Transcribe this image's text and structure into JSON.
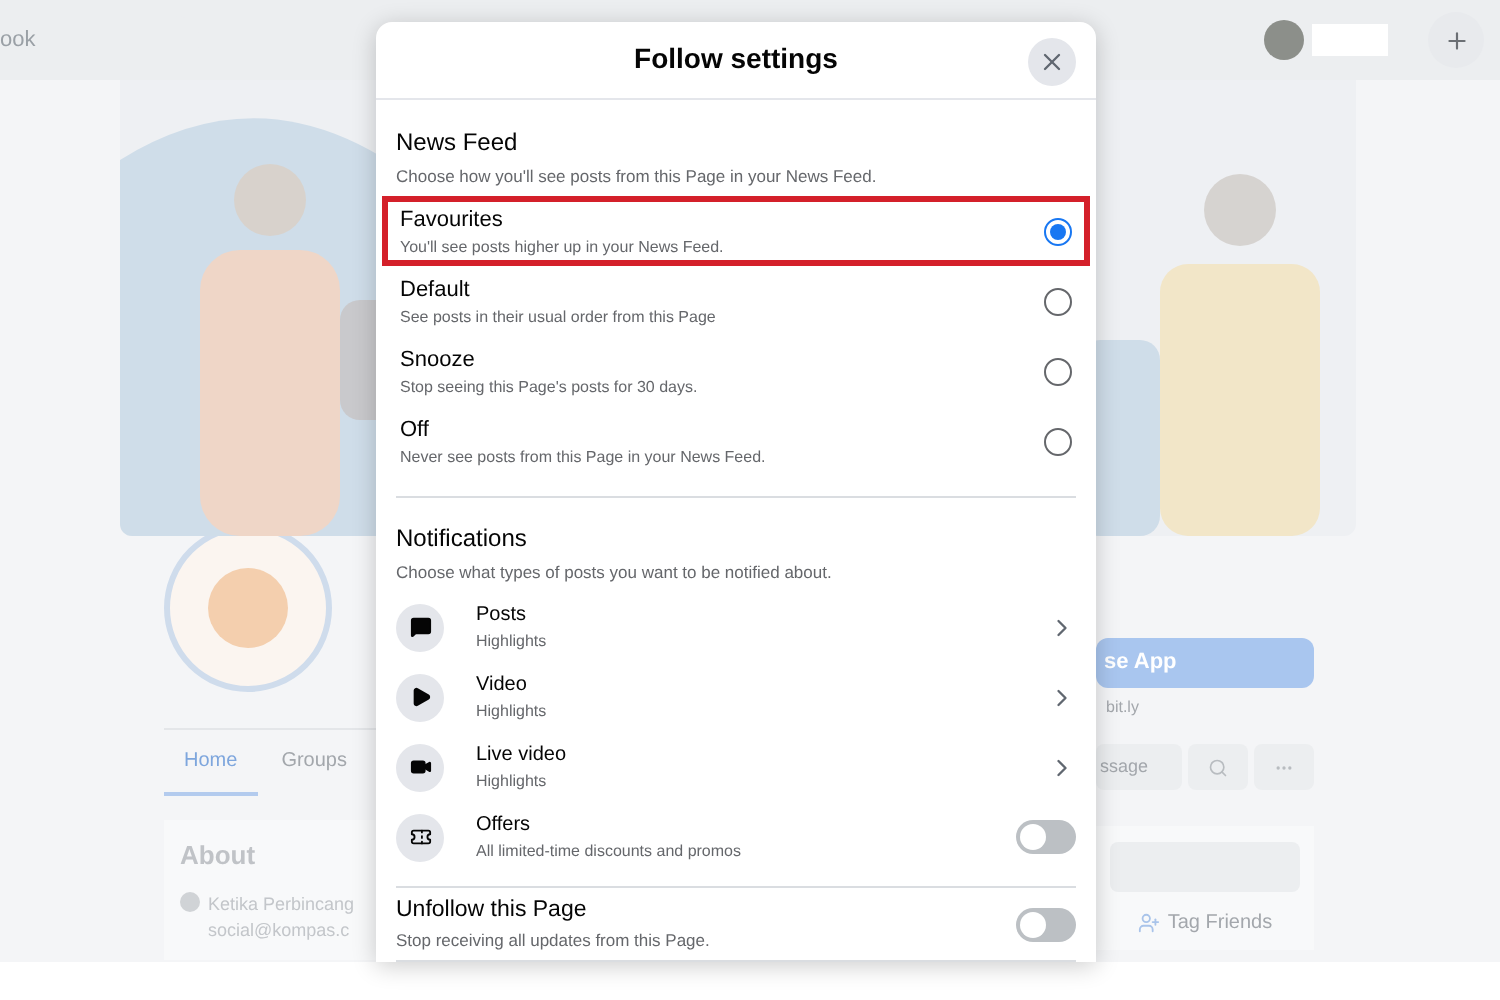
{
  "page": {
    "search": {
      "placeholder": "ook"
    },
    "tabs": [
      {
        "label": "Home",
        "selected": true
      },
      {
        "label": "Groups",
        "selected": false
      }
    ],
    "app_button": "se App",
    "app_caption": "bit.ly",
    "message_button": "ssage",
    "about": {
      "title": "About",
      "text": "Ketika Perbincang",
      "email": "social@kompas.c"
    },
    "tag_friends": "Tag Friends"
  },
  "dialog": {
    "title": "Follow settings",
    "news_feed": {
      "title": "News Feed",
      "subtitle": "Choose how you'll see posts from this Page in your News Feed.",
      "options": [
        {
          "label": "Favourites",
          "description": "You'll see posts higher up in your News Feed.",
          "selected": true,
          "highlighted": true
        },
        {
          "label": "Default",
          "description": "See posts in their usual order from this Page",
          "selected": false,
          "highlighted": false
        },
        {
          "label": "Snooze",
          "description": "Stop seeing this Page's posts for 30 days.",
          "selected": false,
          "highlighted": false
        },
        {
          "label": "Off",
          "description": "Never see posts from this Page in your News Feed.",
          "selected": false,
          "highlighted": false
        }
      ]
    },
    "notifications": {
      "title": "Notifications",
      "subtitle": "Choose what types of posts you want to be notified about.",
      "items": [
        {
          "kind": "submenu",
          "label": "Posts",
          "description": "Highlights"
        },
        {
          "kind": "submenu",
          "label": "Video",
          "description": "Highlights"
        },
        {
          "kind": "submenu",
          "label": "Live video",
          "description": "Highlights"
        },
        {
          "kind": "toggle",
          "label": "Offers",
          "description": "All limited-time discounts and promos",
          "on": false
        }
      ]
    },
    "unfollow": {
      "title": "Unfollow this Page",
      "description": "Stop receiving all updates from this Page.",
      "on": false
    }
  }
}
